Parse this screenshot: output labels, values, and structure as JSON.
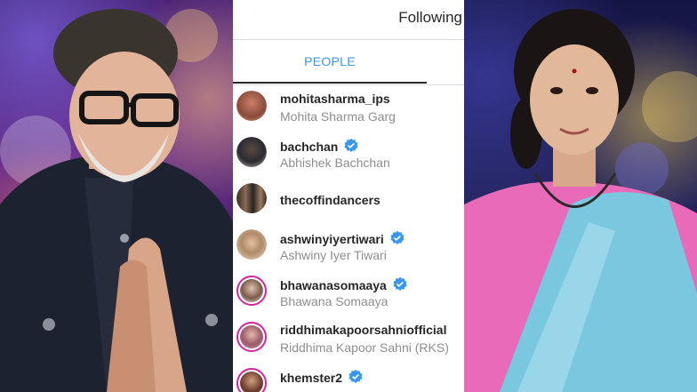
{
  "header": {
    "title": "Following"
  },
  "tabs": [
    {
      "label": "PEOPLE",
      "active": true
    }
  ],
  "accounts": [
    {
      "username": "mohitasharma_ips",
      "full_name": "Mohita Sharma Garg",
      "verified": false
    },
    {
      "username": "bachchan",
      "full_name": "Abhishek Bachchan",
      "verified": true
    },
    {
      "username": "thecoffindancers",
      "full_name": "",
      "verified": false
    },
    {
      "username": "ashwinyiyertiwari",
      "full_name": "Ashwiny Iyer Tiwari",
      "verified": true
    },
    {
      "username": "bhawanasomaaya",
      "full_name": "Bhawana Somaaya",
      "verified": true
    },
    {
      "username": "riddhimakapoorsahniofficial",
      "full_name": "Riddhima Kapoor Sahni (RKS)",
      "verified": false
    },
    {
      "username": "khemster2",
      "full_name": "",
      "verified": true
    }
  ],
  "colors": {
    "accent": "#3897f0",
    "verified_badge": "#3897f0",
    "story_ring": "#d6249f"
  }
}
